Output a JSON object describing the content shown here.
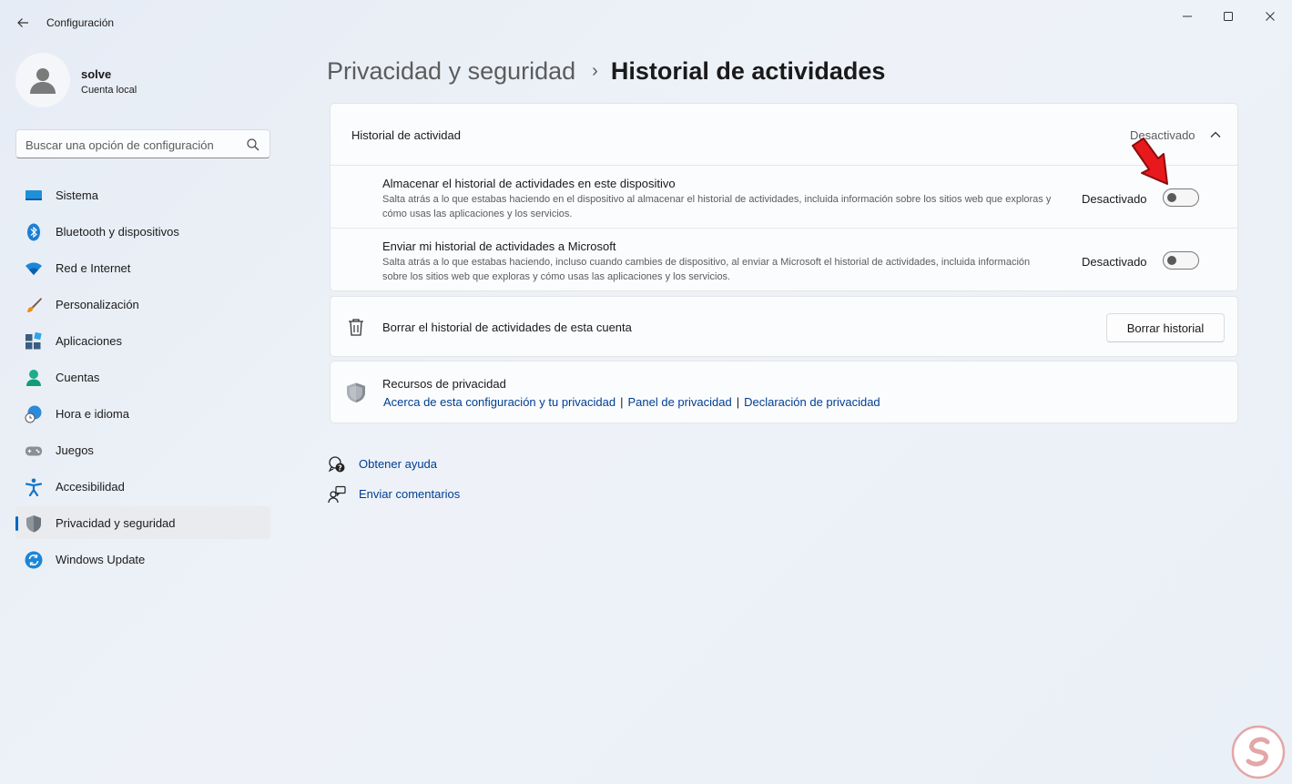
{
  "window": {
    "title": "Configuración",
    "controls": [
      "minimize",
      "maximize",
      "close"
    ]
  },
  "profile": {
    "name": "solve",
    "account_type": "Cuenta local"
  },
  "search": {
    "placeholder": "Buscar una opción de configuración"
  },
  "sidebar": {
    "items": [
      {
        "label": "Sistema",
        "icon": "monitor-icon"
      },
      {
        "label": "Bluetooth y dispositivos",
        "icon": "bluetooth-icon"
      },
      {
        "label": "Red e Internet",
        "icon": "wifi-icon"
      },
      {
        "label": "Personalización",
        "icon": "brush-icon"
      },
      {
        "label": "Aplicaciones",
        "icon": "apps-icon"
      },
      {
        "label": "Cuentas",
        "icon": "person-icon"
      },
      {
        "label": "Hora e idioma",
        "icon": "globe-clock-icon"
      },
      {
        "label": "Juegos",
        "icon": "gamepad-icon"
      },
      {
        "label": "Accesibilidad",
        "icon": "accessibility-icon"
      },
      {
        "label": "Privacidad y seguridad",
        "icon": "shield-icon",
        "active": true
      },
      {
        "label": "Windows Update",
        "icon": "update-icon"
      }
    ]
  },
  "breadcrumb": {
    "parent": "Privacidad y seguridad",
    "separator": "›",
    "current": "Historial de actividades"
  },
  "activity_card": {
    "header_title": "Historial de actividad",
    "header_status": "Desactivado",
    "rows": [
      {
        "title": "Almacenar el historial de actividades en este dispositivo",
        "description": "Salta atrás a lo que estabas haciendo en el dispositivo al almacenar el historial de actividades, incluida información sobre los sitios web que exploras y cómo usas las aplicaciones y los servicios.",
        "status": "Desactivado",
        "toggle_on": false
      },
      {
        "title": "Enviar mi historial de actividades a Microsoft",
        "description": "Salta atrás a lo que estabas haciendo, incluso cuando cambies de dispositivo, al enviar a Microsoft el historial de actividades, incluida información sobre los sitios web que exploras y cómo usas las aplicaciones y los servicios.",
        "status": "Desactivado",
        "toggle_on": false
      }
    ]
  },
  "clear_card": {
    "title": "Borrar el historial de actividades de esta cuenta",
    "button_label": "Borrar historial"
  },
  "privacy_card": {
    "title": "Recursos de privacidad",
    "links": [
      "Acerca de esta configuración y tu privacidad",
      "Panel de privacidad",
      "Declaración de privacidad"
    ],
    "link_separator": "|"
  },
  "help": {
    "get_help": "Obtener ayuda",
    "send_feedback": "Enviar comentarios"
  },
  "colors": {
    "accent": "#0067c0",
    "link": "#003e92",
    "annotation_arrow": "#e8191c"
  }
}
